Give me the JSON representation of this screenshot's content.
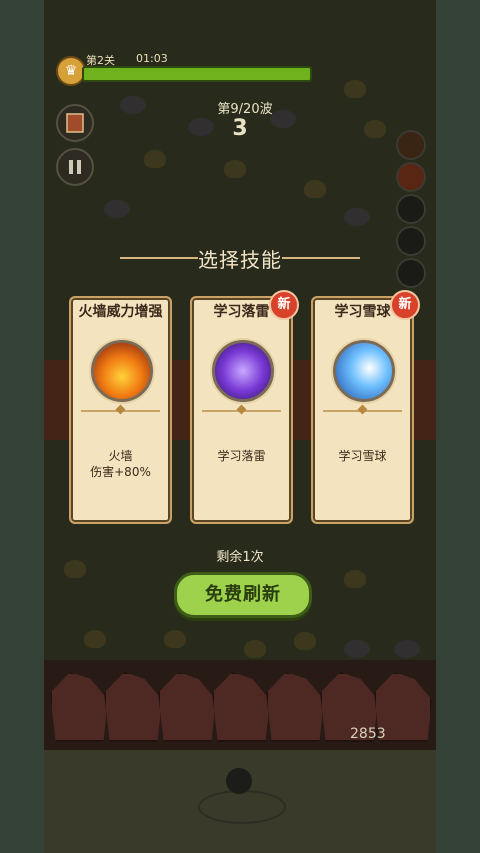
{
  "hud": {
    "level_icon": "lion-head-icon",
    "level_label": "第2关",
    "timer": "01:03",
    "wave_label": "第9/20波",
    "wave_count": "3",
    "hp_fraction": 1.0
  },
  "side_buttons": [
    "book-icon",
    "pause-icon"
  ],
  "skill_slot_icons": [
    "fire-slot-icon",
    "fire-slot-icon",
    "empty-slot",
    "empty-slot",
    "empty-slot"
  ],
  "dialog": {
    "title": "选择技能",
    "cards": [
      {
        "name": "火墙威力增强",
        "icon": "fire-wall-icon",
        "description": "火墙\n伤害+80%",
        "is_new": false
      },
      {
        "name": "学习落雷",
        "icon": "lightning-icon",
        "description": "学习落雷",
        "is_new": true,
        "badge": "新"
      },
      {
        "name": "学习雪球",
        "icon": "snowball-icon",
        "description": "学习雪球",
        "is_new": true,
        "badge": "新"
      }
    ],
    "remaining": "剩余1次",
    "refresh_button": "免费刷新"
  },
  "score": "2853",
  "colors": {
    "card_bg": "#f3e4bf",
    "button_green": "#9ed24c",
    "badge_red": "#d8422b",
    "hp_green": "#6fb21d"
  }
}
